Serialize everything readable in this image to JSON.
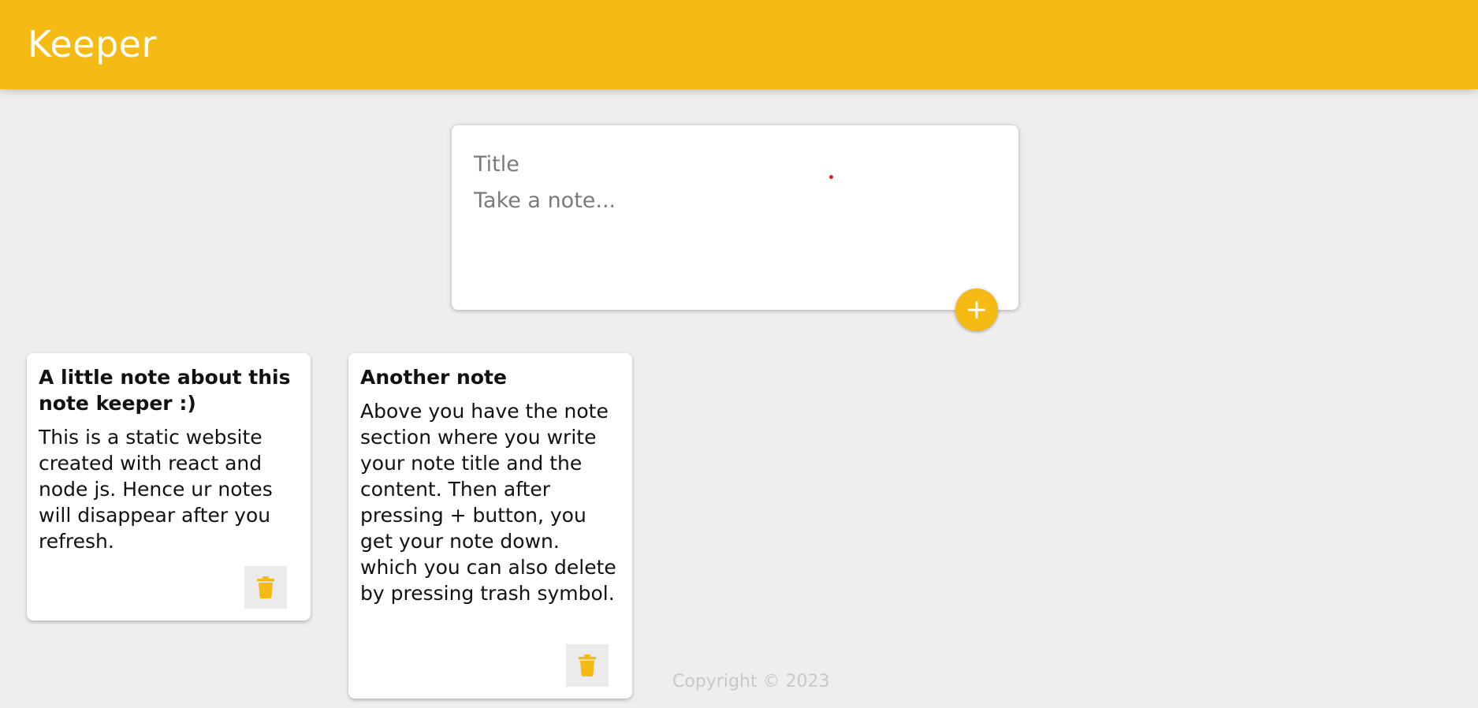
{
  "header": {
    "logo": "Keeper",
    "background_color": "#f5ba13"
  },
  "create_note": {
    "title_placeholder": "Title",
    "content_placeholder": "Take a note...",
    "add_button_icon": "plus-icon"
  },
  "notes": [
    {
      "title": "A little note about this note keeper :)",
      "content": "This is a static website created with react and node js. Hence ur notes will disappear after you refresh.",
      "delete_icon": "trash-icon"
    },
    {
      "title": "Another note",
      "content": "Above you have the note section where you write your note title and the content. Then after pressing + button, you get your note down. which you can also delete by pressing trash symbol.",
      "delete_icon": "trash-icon"
    }
  ],
  "footer": {
    "text": "Copyright © 2023"
  },
  "colors": {
    "accent": "#f5ba13",
    "background": "#eeeeee",
    "card": "#ffffff",
    "footer_text": "#c8c8c8"
  }
}
